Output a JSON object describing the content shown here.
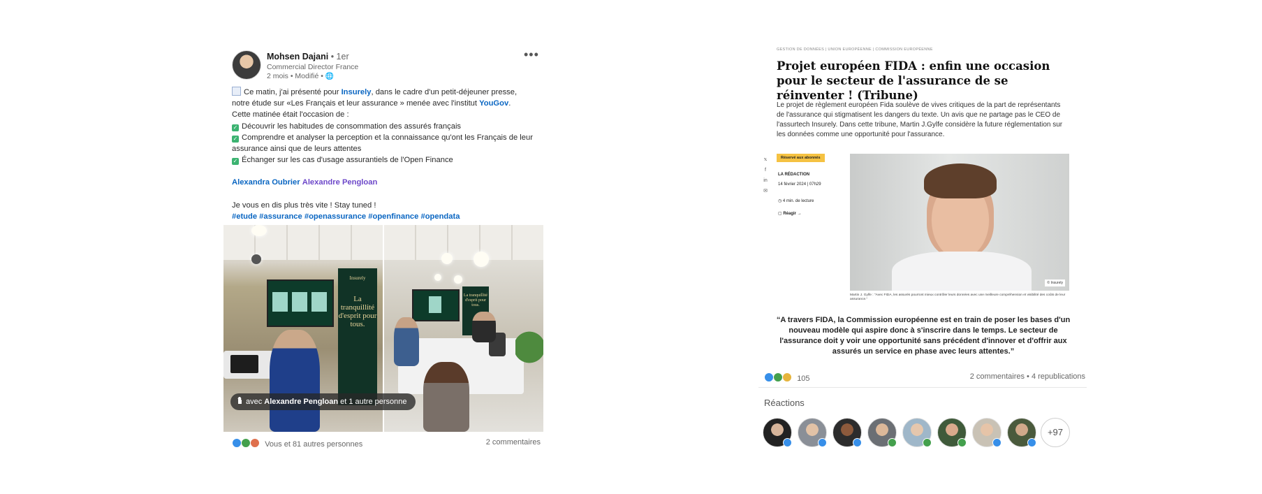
{
  "left_post": {
    "author": {
      "name": "Mohsen Dajani",
      "degree": "• 1er",
      "title": "Commercial Director France",
      "meta": "2 mois • Modifié •"
    },
    "body": {
      "line1_pre": "Ce matin, j'ai présenté pour ",
      "line1_link": "Insurely",
      "line1_post": ", dans le cadre d'un petit-déjeuner presse,",
      "line2_pre": "notre étude sur «Les Français et leur assurance » menée avec l'institut ",
      "line2_link": "YouGov",
      "line2_post": ".",
      "line3": "Cette matinée était l'occasion de :",
      "bullet1": "Découvrir les habitudes de consommation des assurés français",
      "bullet2": "Comprendre et analyser la perception et la connaissance qu'ont les Français de leur assurance ainsi que de leurs attentes",
      "bullet3": "Échanger sur les cas d'usage assurantiels de l'Open Finance",
      "mention1": "Alexandra Oubrier",
      "mention2": "Alexandre Pengloan",
      "closing": "Je vous en dis plus très vite ! Stay tuned !",
      "hashtags": "#etude #assurance #openassurance #openfinance #opendata"
    },
    "photo_tag": {
      "pre": "avec ",
      "name": "Alexandre Pengloan",
      "post": " et 1 autre personne"
    },
    "banner_text": "La tranquillité d'esprit pour tous.",
    "reactions": "Vous et 81 autres personnes",
    "comments": "2 commentaires"
  },
  "right_post": {
    "breadcrumbs": "GESTION DE DONNÉES  |  UNION EUROPÉENNE  |  COMMISSION EUROPÉENNE",
    "title": "Projet européen FIDA : enfin une occasion pour le secteur de l'assurance de se réinventer ! (Tribune)",
    "intro": "Le projet de règlement européen Fida soulève de vives critiques de la part  de représentants de l'assurance qui stigmatisent les dangers du texte. Un avis que ne partage pas le CEO de l'assurtech Insurely. Dans cette tribune, Martin J.Gylfe considère la future réglementation sur les données comme une opportunité pour l'assurance.",
    "badge": "Réservé aux abonnés",
    "author": "LA RÉDACTION",
    "date": "14 février 2024  |  07h29",
    "read_time": "4 min. de lecture",
    "react": "Réagir →",
    "credit": "© Insurely",
    "caption": "Martin J. Gylfe : \"Avec FIDA, les assurés pourront mieux contrôler leurs données avec une meilleure compréhension et visibilité des coûts de leur assurance.\"",
    "quote": "“A travers FIDA, la Commission européenne est en train de poser les bases d'un nouveau modèle qui aspire donc à s'inscrire dans le temps. Le secteur de l'assurance doit y voir une opportunité sans précédent d'innover et d'offrir aux assurés un service en phase avec leurs attentes.”",
    "reaction_count": "105",
    "stats": "2 commentaires • 4 republications",
    "reactions_title": "Réactions",
    "more_reactors": "+97"
  },
  "colors": {
    "link": "#0a66c2",
    "mention": "#6c47c9",
    "badge": "#f5c242",
    "check": "#3cb371"
  }
}
